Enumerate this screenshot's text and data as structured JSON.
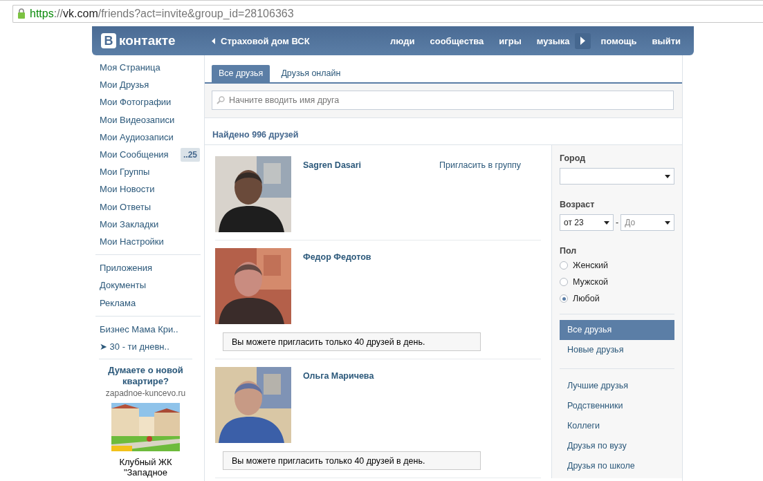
{
  "browser": {
    "url": {
      "scheme": "https",
      "separator": "://",
      "host": "vk.com",
      "path": "/friends?act=invite&group_id=28106363"
    }
  },
  "header": {
    "logo_letter": "В",
    "logo_text": "контакте",
    "back_link": "Страховой дом ВСК",
    "nav": [
      {
        "kind": "link",
        "label": "люди"
      },
      {
        "kind": "link",
        "label": "сообщества"
      },
      {
        "kind": "link",
        "label": "игры"
      },
      {
        "kind": "link",
        "label": "музыка"
      },
      {
        "kind": "player"
      },
      {
        "kind": "link",
        "label": "помощь"
      },
      {
        "kind": "link",
        "label": "выйти"
      }
    ]
  },
  "sidebar": {
    "groups": [
      [
        {
          "label": "Моя Страница"
        },
        {
          "label": "Мои Друзья"
        },
        {
          "label": "Мои Фотографии"
        },
        {
          "label": "Мои Видеозаписи"
        },
        {
          "label": "Мои Аудиозаписи"
        },
        {
          "label": "Мои Сообщения",
          "badge": "..25"
        },
        {
          "label": "Мои Группы"
        },
        {
          "label": "Мои Новости"
        },
        {
          "label": "Мои Ответы"
        },
        {
          "label": "Мои Закладки"
        },
        {
          "label": "Мои Настройки"
        }
      ],
      [
        {
          "label": "Приложения"
        },
        {
          "label": "Документы"
        },
        {
          "label": "Реклама"
        }
      ],
      [
        {
          "label": "Бизнес Мама Кри.."
        },
        {
          "label": "➤ 30 - ти дневн.."
        }
      ]
    ],
    "ad": {
      "title": "Думаете о новой квартире?",
      "domain": "zapadnoe-kuncevo.ru",
      "caption": "Клубный ЖК \"Западное"
    }
  },
  "tabs": [
    {
      "label": "Все друзья",
      "selected": true
    },
    {
      "label": "Друзья онлайн",
      "selected": false
    }
  ],
  "search": {
    "placeholder": "Начните вводить имя друга"
  },
  "found": "Найдено 996 друзей",
  "friends": [
    {
      "name": "Sagren Dasari",
      "invite_link": "Пригласить в группу"
    },
    {
      "name": "Федор Федотов",
      "notice": "Вы можете пригласить только 40 друзей в день."
    },
    {
      "name": "Ольга Маричева",
      "notice": "Вы можете пригласить только 40 друзей в день."
    }
  ],
  "filters": {
    "city_label": "Город",
    "age_label": "Возраст",
    "age_from": "от 23",
    "age_separator": "-",
    "age_to_placeholder": "До",
    "sex_label": "Пол",
    "sex_options": [
      {
        "label": "Женский",
        "selected": false
      },
      {
        "label": "Мужской",
        "selected": false
      },
      {
        "label": "Любой",
        "selected": true
      }
    ],
    "lists": [
      [
        {
          "label": "Все друзья",
          "selected": true
        },
        {
          "label": "Новые друзья",
          "selected": false
        }
      ],
      [
        {
          "label": "Лучшие друзья",
          "selected": false
        },
        {
          "label": "Родственники",
          "selected": false
        },
        {
          "label": "Коллеги",
          "selected": false
        },
        {
          "label": "Друзья по вузу",
          "selected": false
        },
        {
          "label": "Друзья по школе",
          "selected": false
        }
      ]
    ]
  }
}
